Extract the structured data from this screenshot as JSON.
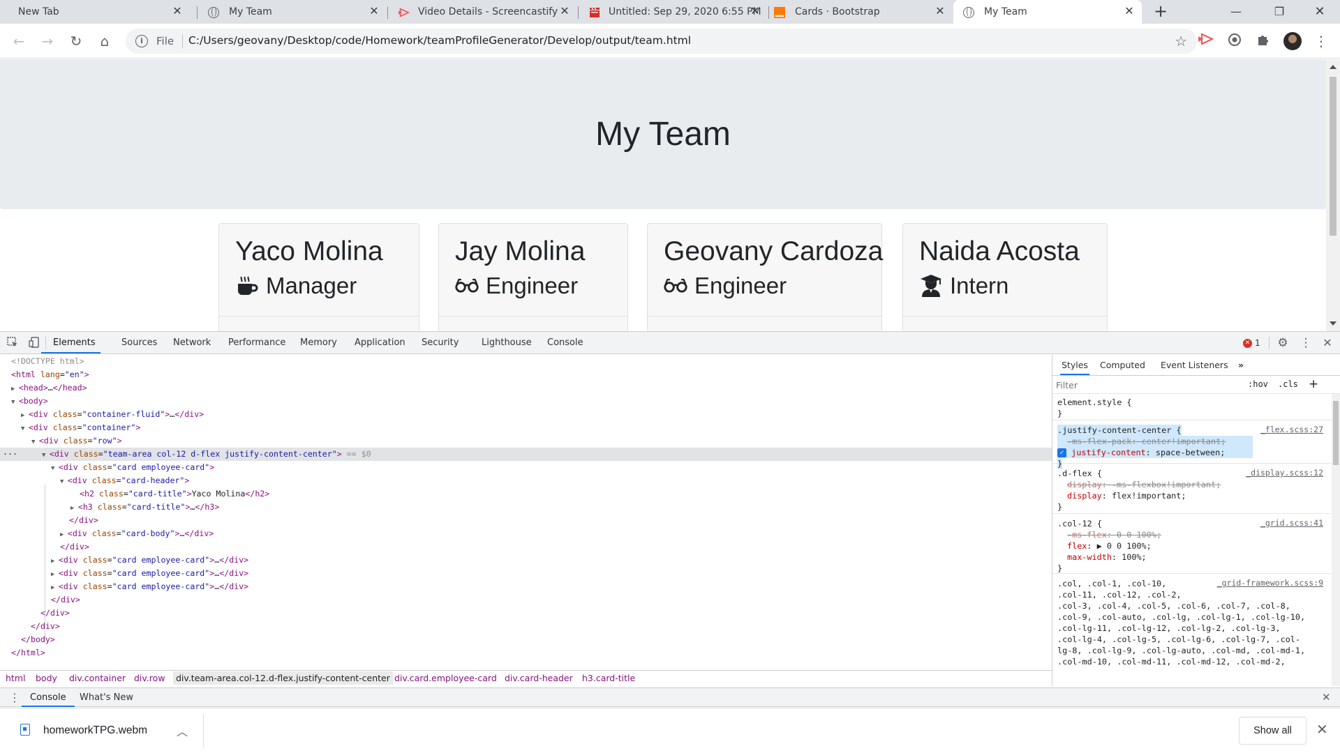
{
  "tabs": [
    {
      "title": "New Tab",
      "icon": "none"
    },
    {
      "title": "My Team",
      "icon": "globe-icon"
    },
    {
      "title": "Video Details - Screencastify",
      "icon": "screencastify-icon"
    },
    {
      "title": "Untitled: Sep 29, 2020 6:55 PM",
      "icon": "clapperboard-icon"
    },
    {
      "title": "Cards · Bootstrap",
      "icon": "orange-square-icon"
    },
    {
      "title": "My Team",
      "icon": "globe-icon",
      "active": true
    }
  ],
  "toolbar": {
    "scheme": "File",
    "url": "C:/Users/geovany/Desktop/code/Homework/teamProfileGenerator/Develop/output/team.html"
  },
  "page": {
    "heading": "My Team",
    "cards": [
      {
        "name": "Yaco Molina",
        "role": "Manager",
        "icon": "coffee-mug-icon"
      },
      {
        "name": "Jay Molina",
        "role": "Engineer",
        "icon": "glasses-icon"
      },
      {
        "name": "Geovany Cardoza",
        "role": "Engineer",
        "icon": "glasses-icon"
      },
      {
        "name": "Naida Acosta",
        "role": "Intern",
        "icon": "graduate-icon"
      }
    ]
  },
  "devtools": {
    "tabs": [
      "Elements",
      "Sources",
      "Network",
      "Performance",
      "Memory",
      "Application",
      "Security",
      "Lighthouse",
      "Console"
    ],
    "active_tab": "Elements",
    "error_count": "1",
    "dom_lines": {
      "doctype": "<!DOCTYPE html>",
      "html_tag": "html",
      "lang_attr": "lang",
      "lang_val": "\"en\"",
      "head": "head",
      "body": "body",
      "div": "div",
      "class_attr": "class",
      "container_fluid": "\"container-fluid\"",
      "container": "\"container\"",
      "row": "\"row\"",
      "team_area": "\"team-area col-12 d-flex justify-content-center\"",
      "eq_ref": "== $0",
      "card": "\"card employee-card\"",
      "card_header": "\"card-header\"",
      "h2": "h2",
      "h3": "h3",
      "card_title": "\"card-title\"",
      "h2_text": "Yaco Molina",
      "card_body": "\"card-body\"",
      "ellipsis": "…"
    },
    "breadcrumbs": [
      "html",
      "body",
      "div.container",
      "div.row",
      "div.team-area.col-12.d-flex.justify-content-center",
      "div.card.employee-card",
      "div.card-header",
      "h3.card-title"
    ],
    "styles": {
      "tabs": [
        "Styles",
        "Computed",
        "Event Listeners"
      ],
      "filter_placeholder": "Filter",
      "hov": ":hov",
      "cls": ".cls",
      "element_style": "element.style {",
      "close_brace": "}",
      "rule1": {
        "selector": ".justify-content-center {",
        "source": "_flex.scss:27",
        "decl1_prop": "-ms-flex-pack",
        "decl1_val": "center!important;",
        "decl2_prop": "justify-content",
        "decl2_val": "space-between;"
      },
      "rule2": {
        "selector": ".d-flex {",
        "source": "_display.scss:12",
        "decl1_prop": "display",
        "decl1_val": "-ms-flexbox!important;",
        "decl2_prop": "display",
        "decl2_val": "flex!important;"
      },
      "rule3": {
        "selector": ".col-12 {",
        "source": "_grid.scss:41",
        "decl1_prop": "-ms-flex",
        "decl1_val": "0 0 100%;",
        "decl2_prop": "flex",
        "decl2_val": "▶ 0 0 100%;",
        "decl3_prop": "max-width",
        "decl3_val": "100%;"
      },
      "rule4": {
        "source": "_grid-framework.scss:9",
        "lines": [
          ".col, .col-1, .col-10,",
          ".col-11, .col-12, .col-2,",
          ".col-3, .col-4, .col-5, .col-6, .col-7, .col-8,",
          ".col-9, .col-auto, .col-lg, .col-lg-1, .col-lg-10,",
          ".col-lg-11, .col-lg-12, .col-lg-2, .col-lg-3,",
          ".col-lg-4, .col-lg-5, .col-lg-6, .col-lg-7, .col-",
          "lg-8, .col-lg-9, .col-lg-auto, .col-md, .col-md-1,",
          ".col-md-10, .col-md-11, .col-md-12, .col-md-2,"
        ]
      }
    },
    "drawer_tabs": [
      "Console",
      "What's New"
    ]
  },
  "downloads": {
    "file": "homeworkTPG.webm",
    "show_all": "Show all"
  }
}
